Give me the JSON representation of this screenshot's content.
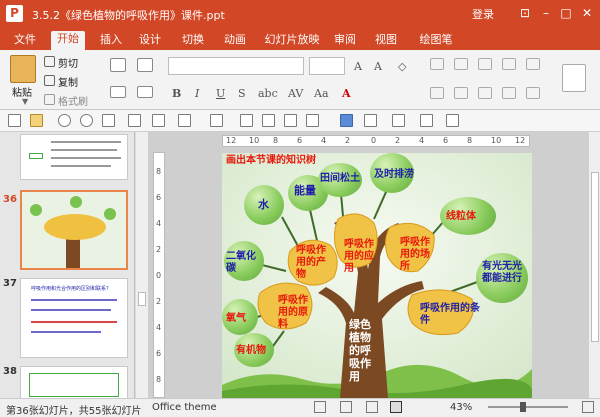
{
  "window": {
    "title": "3.5.2《绿色植物的呼吸作用》课件.ppt",
    "login_label": "登录",
    "accent_color": "#d24726"
  },
  "menu_tabs": [
    "文件",
    "开始",
    "插入",
    "设计",
    "切换",
    "动画",
    "幻灯片放映",
    "审阅",
    "视图",
    "绘图笔"
  ],
  "ribbon": {
    "paste_label": "粘贴",
    "cut_label": "剪切",
    "copy_label": "复制",
    "format_painter_label": "格式刷"
  },
  "ruler": {
    "h_ticks": [
      "12",
      "10",
      "8",
      "6",
      "4",
      "2",
      "0",
      "2",
      "4",
      "6",
      "8",
      "10",
      "12"
    ],
    "v_ticks": [
      "8",
      "6",
      "4",
      "2",
      "0",
      "2",
      "4",
      "6",
      "8"
    ]
  },
  "slides": [
    {
      "number": "",
      "selected": false
    },
    {
      "number": "36",
      "selected": true
    },
    {
      "number": "37",
      "selected": false,
      "title": "呼吸作用和光合作用的区别和联系？"
    },
    {
      "number": "38",
      "selected": false
    }
  ],
  "slide": {
    "heading": "画出本节课的知识树",
    "leaves": {
      "water": "水",
      "energy": "能量",
      "field_loosen": "田间松土",
      "timely_drain": "及时排涝",
      "mitochondria": "线粒体",
      "co2": "二氧化碳",
      "oxygen": "氧气",
      "organic": "有机物",
      "light_conditions": "有光无光都能进行"
    },
    "petals": {
      "product": "呼吸作用的产物",
      "application": "呼吸作用的应用",
      "location": "呼吸作用的场所",
      "materials": "呼吸作用的原料",
      "conditions": "呼吸作用的条件"
    },
    "trunk_text": "绿色植物的呼吸作用"
  },
  "status": {
    "slide_position": "第36张幻灯片，共55张幻灯片",
    "theme": "Office theme",
    "zoom": "43%"
  }
}
